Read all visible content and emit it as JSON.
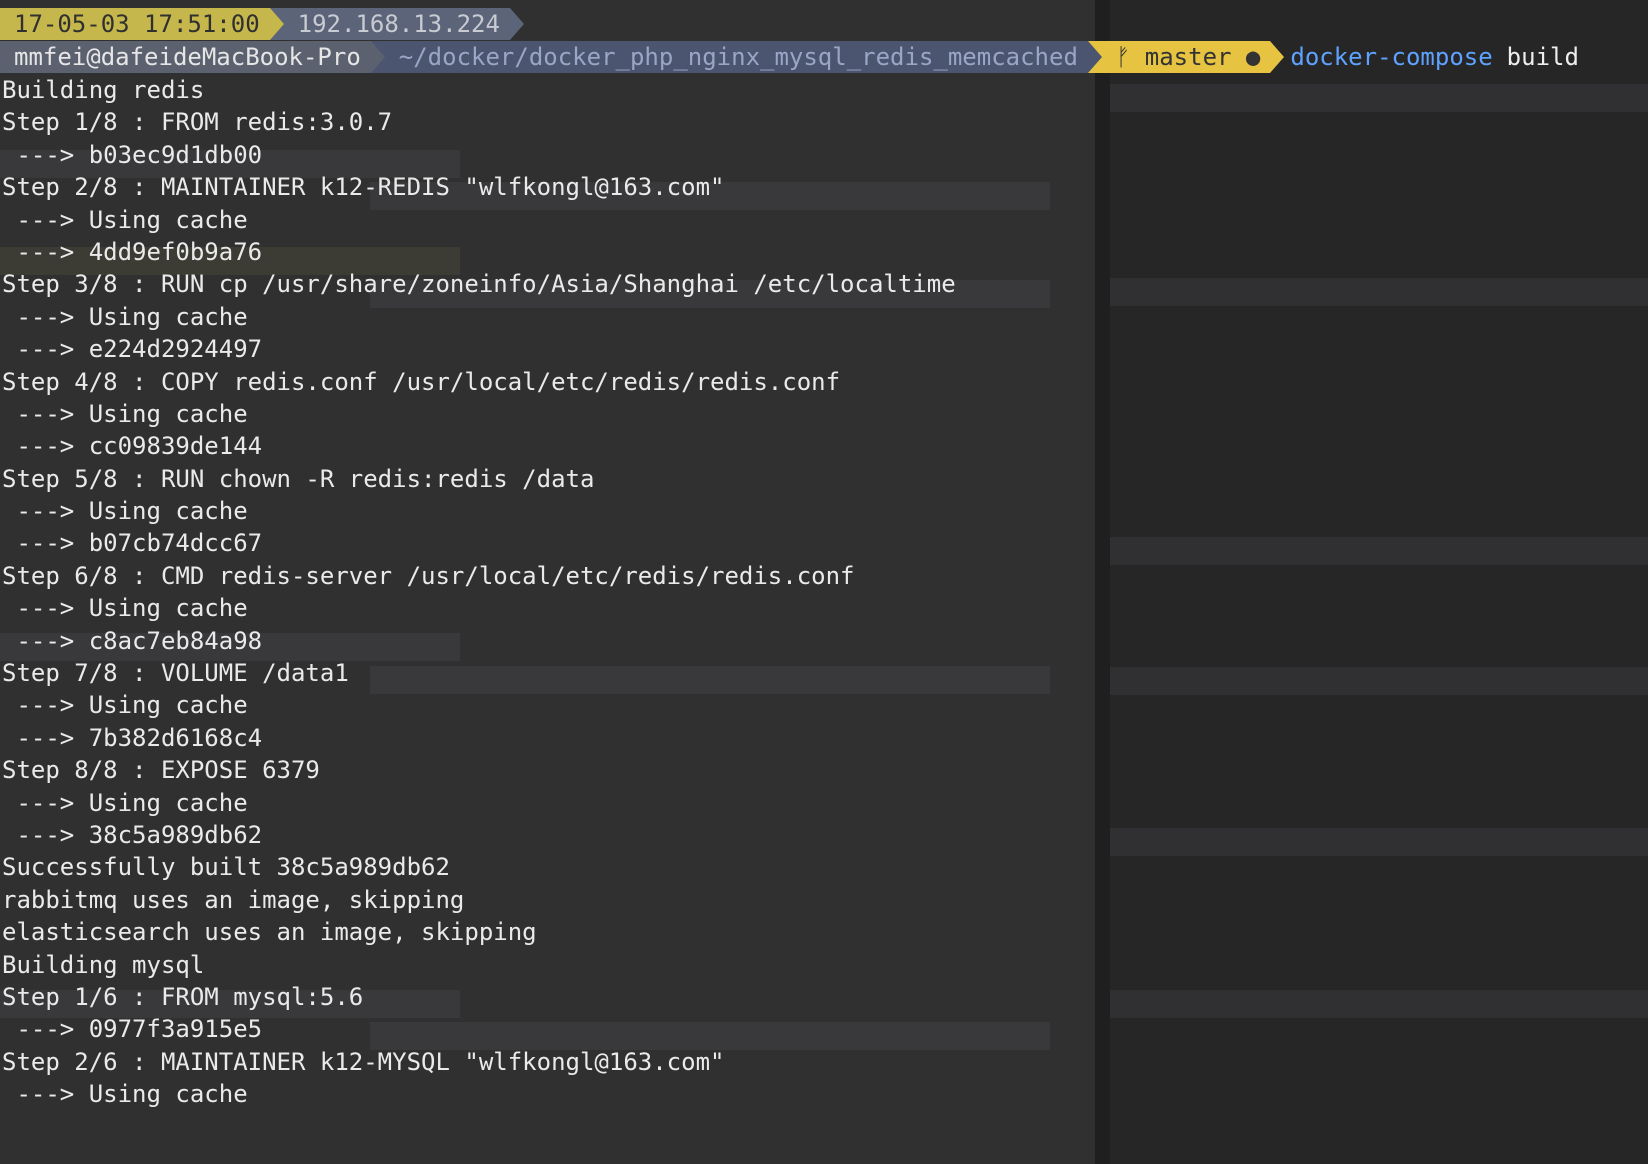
{
  "prompt": {
    "time": "17-05-03 17:51:00",
    "ip": "192.168.13.224",
    "user_host": "mmfei@dafeideMacBook-Pro",
    "path": "~/docker/docker_php_nginx_mysql_redis_memcached",
    "branch_icon": "git-branch-icon",
    "branch": "master",
    "dirty_indicator": "●",
    "command": "docker-compose",
    "args": "build"
  },
  "output_lines": [
    "Building redis",
    "Step 1/8 : FROM redis:3.0.7",
    " ---> b03ec9d1db00",
    "Step 2/8 : MAINTAINER k12-REDIS \"wlfkongl@163.com\"",
    " ---> Using cache",
    " ---> 4dd9ef0b9a76",
    "Step 3/8 : RUN cp /usr/share/zoneinfo/Asia/Shanghai /etc/localtime",
    " ---> Using cache",
    " ---> e224d2924497",
    "Step 4/8 : COPY redis.conf /usr/local/etc/redis/redis.conf",
    " ---> Using cache",
    " ---> cc09839de144",
    "Step 5/8 : RUN chown -R redis:redis /data",
    " ---> Using cache",
    " ---> b07cb74dcc67",
    "Step 6/8 : CMD redis-server /usr/local/etc/redis/redis.conf",
    " ---> Using cache",
    " ---> c8ac7eb84a98",
    "Step 7/8 : VOLUME /data1",
    " ---> Using cache",
    " ---> 7b382d6168c4",
    "Step 8/8 : EXPOSE 6379",
    " ---> Using cache",
    " ---> 38c5a989db62",
    "Successfully built 38c5a989db62",
    "rabbitmq uses an image, skipping",
    "elasticsearch uses an image, skipping",
    "Building mysql",
    "Step 1/6 : FROM mysql:5.6",
    " ---> 0977f3a915e5",
    "Step 2/6 : MAINTAINER k12-MYSQL \"wlfkongl@163.com\"",
    " ---> Using cache"
  ],
  "colors": {
    "time_bg": "#c5b74b",
    "ip_bg": "#5b6478",
    "git_bg": "#e6c341",
    "command": "#5ea2ff",
    "terminal_bg": "#2b2b2b"
  }
}
